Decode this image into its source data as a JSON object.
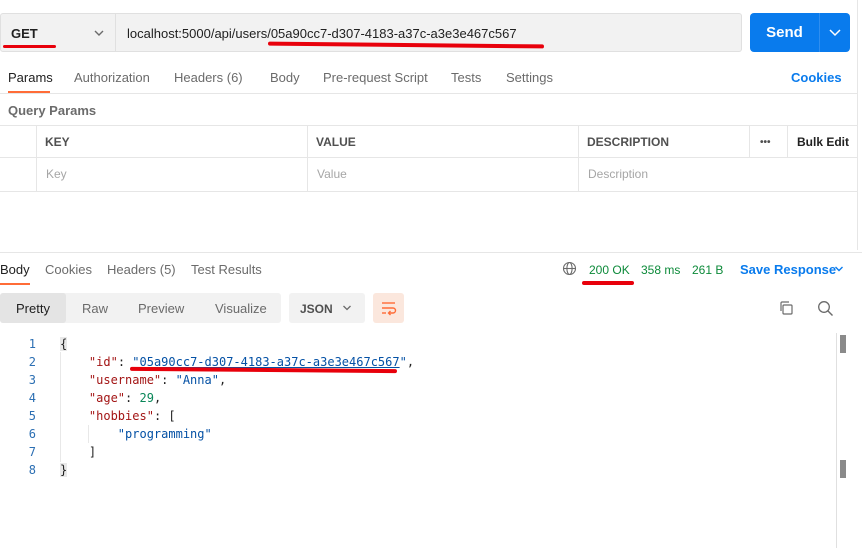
{
  "request": {
    "method": "GET",
    "url": "localhost:5000/api/users/05a90cc7-d307-4183-a37c-a3e3e467c567",
    "send_label": "Send"
  },
  "request_tabs": [
    {
      "label": "Params"
    },
    {
      "label": "Authorization"
    },
    {
      "label": "Headers (6)"
    },
    {
      "label": "Body"
    },
    {
      "label": "Pre-request Script"
    },
    {
      "label": "Tests"
    },
    {
      "label": "Settings"
    }
  ],
  "cookies_label": "Cookies",
  "query_params": {
    "title": "Query Params",
    "headers": {
      "key": "KEY",
      "value": "VALUE",
      "description": "DESCRIPTION",
      "more": "•••",
      "bulk_edit": "Bulk Edit"
    },
    "placeholders": {
      "key": "Key",
      "value": "Value",
      "description": "Description"
    }
  },
  "response_tabs": [
    {
      "label": "Body"
    },
    {
      "label": "Cookies"
    },
    {
      "label": "Headers (5)"
    },
    {
      "label": "Test Results"
    }
  ],
  "response_status": {
    "status": "200 OK",
    "time": "358 ms",
    "size": "261 B",
    "save_label": "Save Response"
  },
  "view_modes": [
    {
      "label": "Pretty"
    },
    {
      "label": "Raw"
    },
    {
      "label": "Preview"
    },
    {
      "label": "Visualize"
    }
  ],
  "format": "JSON",
  "code": {
    "line_numbers": [
      "1",
      "2",
      "3",
      "4",
      "5",
      "6",
      "7",
      "8"
    ],
    "open_brace": "{",
    "close_brace": "}",
    "id_key": "\"id\"",
    "id_value": "05a90cc7-d307-4183-a37c-a3e3e467c567",
    "username_key": "\"username\"",
    "username_value": "\"Anna\"",
    "age_key": "\"age\"",
    "age_value": "29",
    "hobbies_key": "\"hobbies\"",
    "hobby_1": "\"programming\"",
    "open_bracket": "[",
    "close_bracket": "]"
  },
  "colors": {
    "accent": "#097bed",
    "tab_indicator": "#ff6c37",
    "status_ok": "#0d8a3a",
    "annotation": "#e8000b"
  }
}
